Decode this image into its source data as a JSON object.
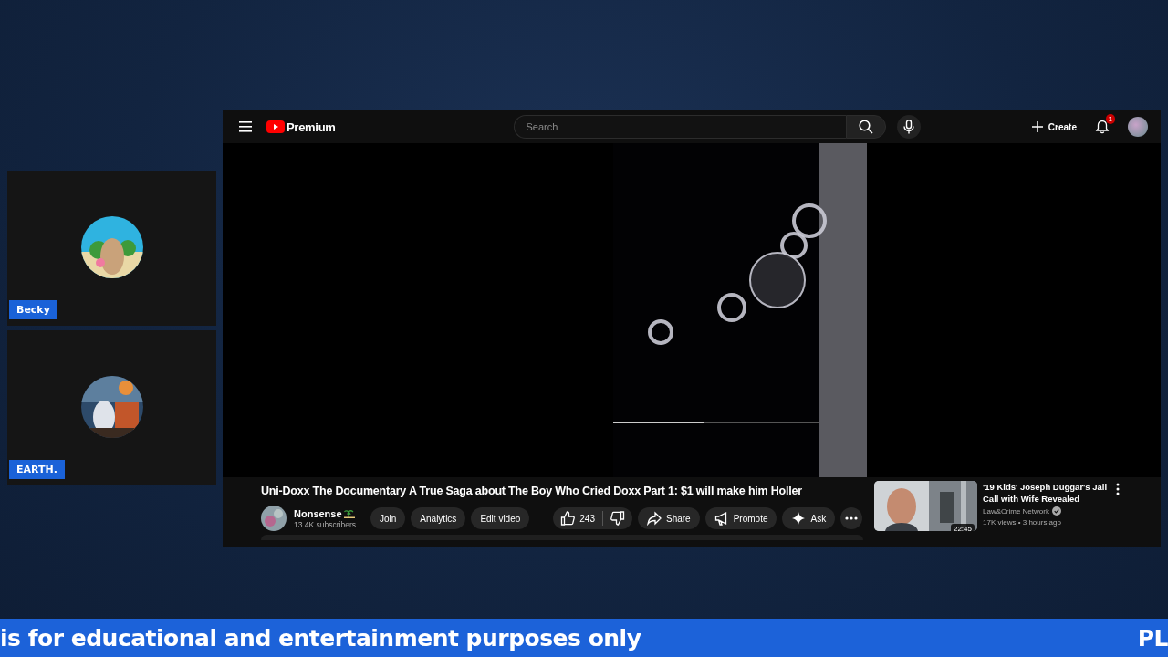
{
  "cams": [
    {
      "name": "Becky"
    },
    {
      "name": "EARTH."
    }
  ],
  "youtube": {
    "brand": "Premium",
    "search": {
      "placeholder": "Search"
    },
    "create": "Create",
    "notifications": "1",
    "title": "Uni-Doxx The Documentary A True Saga about The Boy Who Cried Doxx Part 1: $1 will make him Holler",
    "channel": {
      "name": "Nonsense",
      "subscribers": "13.4K subscribers"
    },
    "channel_buttons": [
      "Join",
      "Analytics",
      "Edit video"
    ],
    "likes": "243",
    "actions": [
      {
        "kind": "share",
        "label": "Share"
      },
      {
        "kind": "promote",
        "label": "Promote"
      },
      {
        "kind": "ask",
        "label": "Ask"
      }
    ],
    "recommended": [
      {
        "title": "'19 Kids' Joseph Duggar's Jail Call with Wife Revealed",
        "channel": "Law&Crime Network",
        "verified": true,
        "meta": "17K views • 3 hours ago",
        "duration": "22:45"
      }
    ]
  },
  "ticker": {
    "left": "is for educational and entertainment purposes only",
    "right": "PL"
  }
}
